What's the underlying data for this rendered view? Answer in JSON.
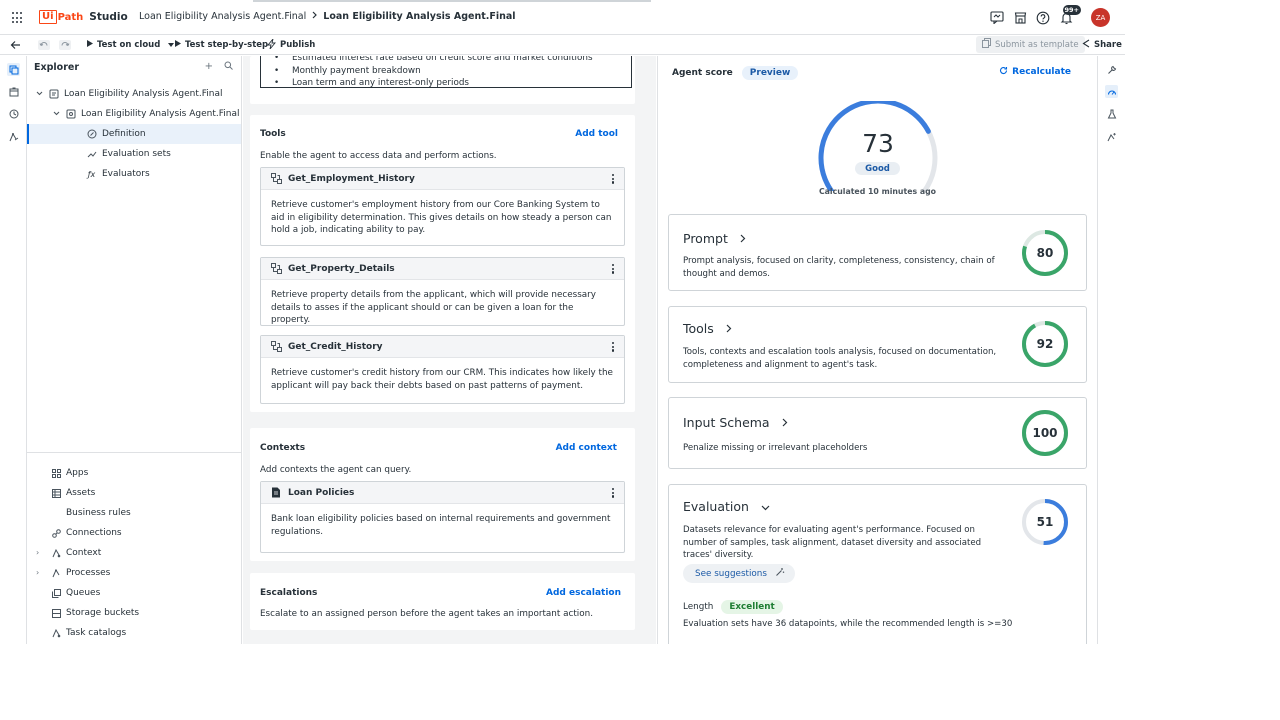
{
  "header": {
    "logo_ui": "Ui",
    "logo_path": "Path",
    "product": "Studio",
    "breadcrumb_parent": "Loan Eligibility Analysis Agent.Final",
    "breadcrumb_current": "Loan Eligibility Analysis Agent.Final",
    "notif_count": "99+",
    "avatar_initials": "ZA"
  },
  "toolbar": {
    "test_cloud": "Test on cloud",
    "test_step": "Test step-by-step",
    "publish": "Publish",
    "submit_template": "Submit as template",
    "share": "Share"
  },
  "explorer": {
    "title": "Explorer",
    "tree": {
      "project": "Loan Eligibility Analysis Agent.Final",
      "agent": "Loan Eligibility Analysis Agent.Final",
      "definition": "Definition",
      "evaluation_sets": "Evaluation sets",
      "evaluators": "Evaluators"
    },
    "resources": {
      "apps": "Apps",
      "assets": "Assets",
      "business_rules": "Business rules",
      "connections": "Connections",
      "context": "Context",
      "processes": "Processes",
      "queues": "Queues",
      "storage_buckets": "Storage buckets",
      "task_catalogs": "Task catalogs"
    }
  },
  "output_bullets": {
    "b1": "Estimated interest rate based on credit score and market conditions",
    "b2": "Monthly payment breakdown",
    "b3": "Loan term and any interest-only periods"
  },
  "tools_section": {
    "title": "Tools",
    "add": "Add tool",
    "desc": "Enable the agent to access data and perform actions.",
    "items": [
      {
        "name": "Get_Employment_History",
        "desc": "Retrieve customer's employment history from our Core Banking System to aid in eligibility determination. This gives details on how steady a person can hold a job, indicating ability to pay."
      },
      {
        "name": "Get_Property_Details",
        "desc": "Retrieve property details from the applicant, which will provide necessary details to asses if the applicant should or can be given a loan for the property."
      },
      {
        "name": "Get_Credit_History",
        "desc": "Retrieve customer's credit history from our CRM. This indicates how likely the applicant will pay back their debts based on past patterns of payment."
      }
    ]
  },
  "contexts_section": {
    "title": "Contexts",
    "add": "Add context",
    "desc": "Add contexts the agent can query.",
    "items": [
      {
        "name": "Loan Policies",
        "desc": "Bank loan eligibility policies based on internal requirements and government regulations."
      }
    ]
  },
  "escalations_section": {
    "title": "Escalations",
    "add": "Add escalation",
    "desc": "Escalate to an assigned person before the agent takes an important action."
  },
  "agent_score": {
    "title": "Agent score",
    "badge": "Preview",
    "recalculate": "Recalculate",
    "score": "73",
    "score_value": 73,
    "rating": "Good",
    "calculated": "Calculated 10 minutes ago",
    "cards": [
      {
        "title": "Prompt",
        "desc": "Prompt analysis, focused on clarity, completeness, consistency, chain of thought and demos.",
        "score": "80",
        "value": 80,
        "color": "#3aa569"
      },
      {
        "title": "Tools",
        "desc": "Tools, contexts and escalation tools analysis, focused on documentation, completeness and alignment to agent's task.",
        "score": "92",
        "value": 92,
        "color": "#3aa569"
      },
      {
        "title": "Input Schema",
        "desc": "Penalize missing or irrelevant placeholders",
        "score": "100",
        "value": 100,
        "color": "#3aa569"
      },
      {
        "title": "Evaluation",
        "desc": "Datasets relevance for evaluating agent's performance. Focused on number of samples, task alignment, dataset diversity and associated traces' diversity.",
        "score": "51",
        "value": 51,
        "color": "#3b7ddd"
      }
    ],
    "see_suggestions": "See suggestions",
    "length_label": "Length",
    "length_badge": "Excellent",
    "length_desc": "Evaluation sets have 36 datapoints, while the recommended length is >=30"
  },
  "colors": {
    "accent": "#0067df",
    "brand": "#fa4616",
    "good": "#3aa569",
    "gauge_blue": "#3b7ddd"
  }
}
